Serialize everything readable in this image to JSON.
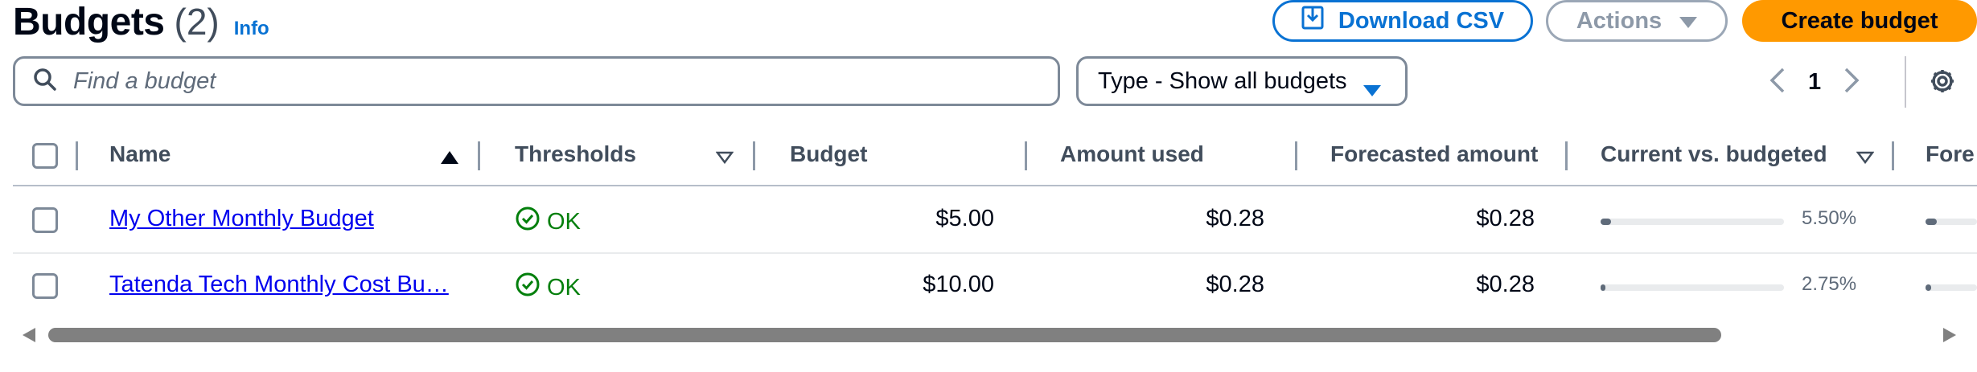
{
  "header": {
    "title": "Budgets",
    "count": "(2)",
    "info_link": "Info"
  },
  "toolbar": {
    "download_label": "Download CSV",
    "actions_label": "Actions",
    "create_label": "Create budget"
  },
  "filters": {
    "search_placeholder": "Find a budget",
    "type_select_value": "Type - Show all budgets"
  },
  "pagination": {
    "current_page": "1"
  },
  "table": {
    "columns": [
      "Name",
      "Thresholds",
      "Budget",
      "Amount used",
      "Forecasted amount",
      "Current vs. budgeted",
      "Fore"
    ],
    "rows": [
      {
        "name": "My Other Monthly Budget",
        "threshold": "OK",
        "budget": "$5.00",
        "amount_used": "$0.28",
        "forecasted": "$0.28",
        "current_vs_budgeted": "5.50%",
        "current_fraction": 0.055,
        "forecast_fraction": 0.055
      },
      {
        "name": "Tatenda Tech Monthly Cost Bu…",
        "threshold": "OK",
        "budget": "$10.00",
        "amount_used": "$0.28",
        "forecasted": "$0.28",
        "current_vs_budgeted": "2.75%",
        "current_fraction": 0.0275,
        "forecast_fraction": 0.0275
      }
    ]
  },
  "colors": {
    "primary": "#ff9900",
    "link": "#0972d3",
    "ok": "#037f0c"
  },
  "icons": [
    "download-icon",
    "caret-down-icon",
    "search-icon",
    "chevron-left-icon",
    "chevron-right-icon",
    "settings-gear-icon",
    "sort-ascending-icon",
    "sort-descending-icon",
    "status-ok-icon"
  ]
}
